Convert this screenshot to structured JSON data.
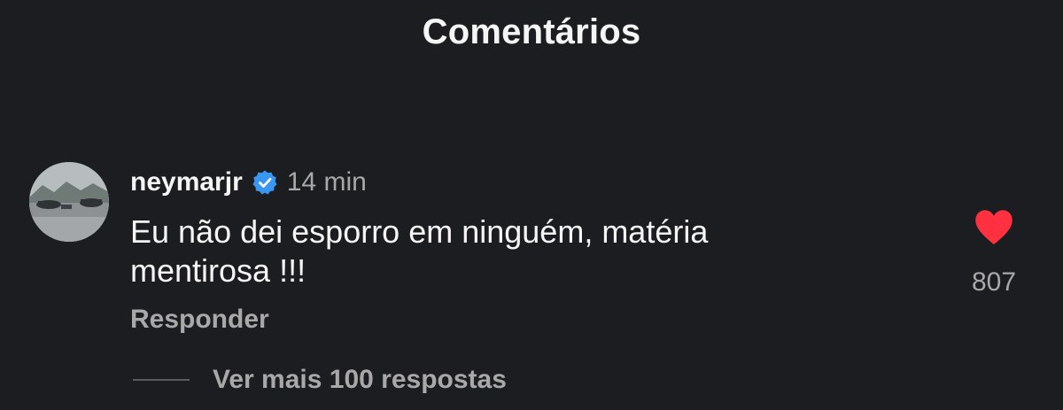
{
  "header": {
    "title": "Comentários"
  },
  "comment": {
    "username": "neymarjr",
    "verified": true,
    "timestamp": "14 min",
    "text": "Eu não dei esporro em ninguém, matéria mentirosa !!!",
    "reply_label": "Responder",
    "liked": true,
    "like_count": "807",
    "view_replies_label": "Ver mais 100 respostas"
  },
  "icons": {
    "verified": "verified-badge-icon",
    "like": "heart-icon"
  },
  "colors": {
    "background": "#1c1d21",
    "primary_text": "#f5f5f5",
    "secondary_text": "#a8a8a8",
    "verified_blue": "#3897f0",
    "like_red": "#ff3040"
  }
}
